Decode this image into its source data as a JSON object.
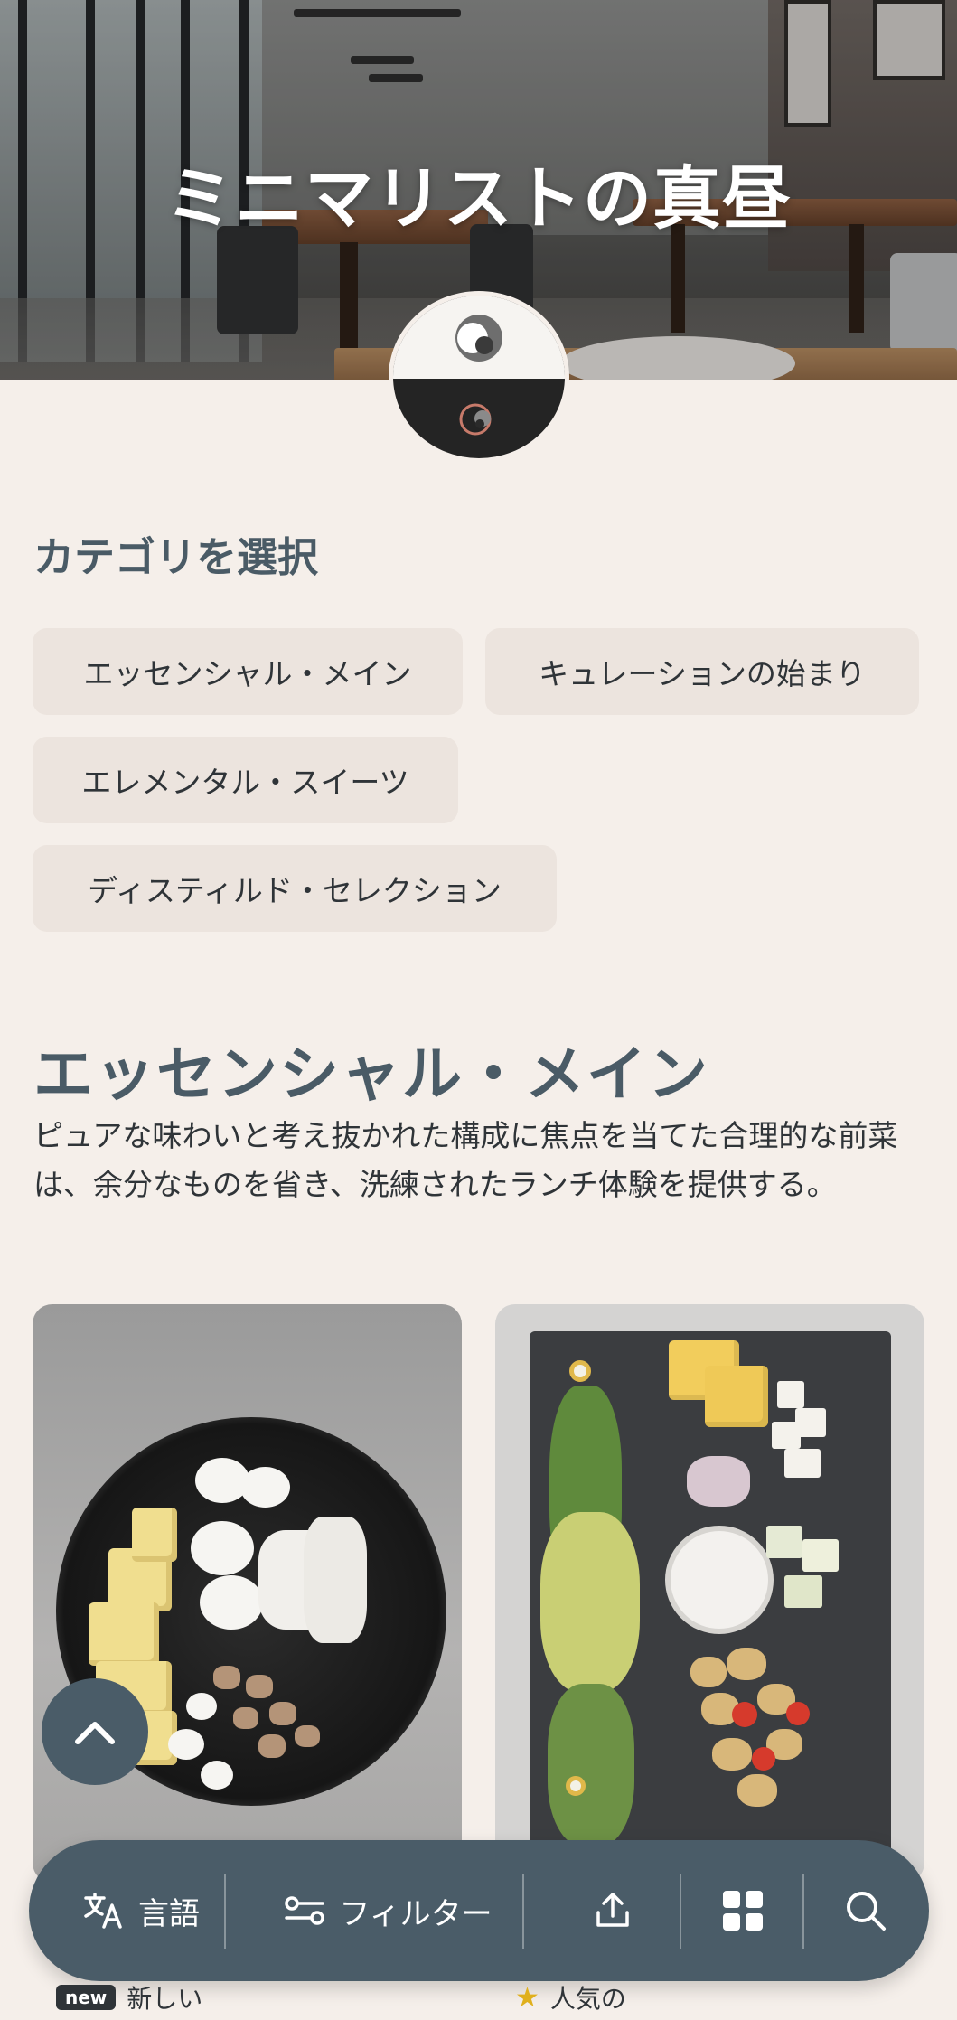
{
  "hero": {
    "title": "ミニマリストの真昼"
  },
  "categories": {
    "heading": "カテゴリを選択",
    "items": [
      {
        "label": "エッセンシャル・メイン"
      },
      {
        "label": "キュレーションの始まり"
      },
      {
        "label": "エレメンタル・スイーツ"
      },
      {
        "label": "ディスティルド・セレクション"
      }
    ]
  },
  "section": {
    "title": "エッセンシャル・メイン",
    "description": "ピュアな味わいと考え抜かれた構成に焦点を当てた合理的な前菜は、余分なものを省き、洗練されたランチ体験を提供する。"
  },
  "bottom_bar": {
    "language_label": "言語",
    "filter_label": "フィルター"
  },
  "hints": {
    "new_badge": "new",
    "new_label": "新しい",
    "popular_label": "人気の"
  },
  "colors": {
    "background": "#f5efea",
    "accent": "#4a5c68",
    "chip": "#ece4de",
    "heading": "#4a5b66"
  },
  "icons": [
    "translate-icon",
    "filter-icon",
    "share-icon",
    "grid-icon",
    "search-icon",
    "chevron-up-icon",
    "star-icon"
  ]
}
